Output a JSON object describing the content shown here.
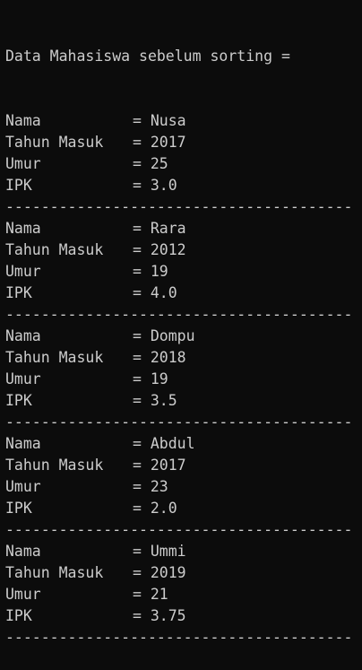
{
  "header": "Data Mahasiswa sebelum sorting =",
  "labels": {
    "nama": "Nama",
    "tahun_masuk": "Tahun Masuk",
    "umur": "Umur",
    "ipk": "IPK"
  },
  "separator": "= ",
  "divider": "---------------------------------------",
  "students": [
    {
      "nama": "Nusa",
      "tahun_masuk": "2017",
      "umur": "25",
      "ipk": "3.0"
    },
    {
      "nama": "Rara",
      "tahun_masuk": "2012",
      "umur": "19",
      "ipk": "4.0"
    },
    {
      "nama": "Dompu",
      "tahun_masuk": "2018",
      "umur": "19",
      "ipk": "3.5"
    },
    {
      "nama": "Abdul",
      "tahun_masuk": "2017",
      "umur": "23",
      "ipk": "2.0"
    },
    {
      "nama": "Ummi",
      "tahun_masuk": "2019",
      "umur": "21",
      "ipk": "3.75"
    }
  ],
  "colors": {
    "background": "#0c0c0c",
    "foreground": "#cccccc"
  }
}
